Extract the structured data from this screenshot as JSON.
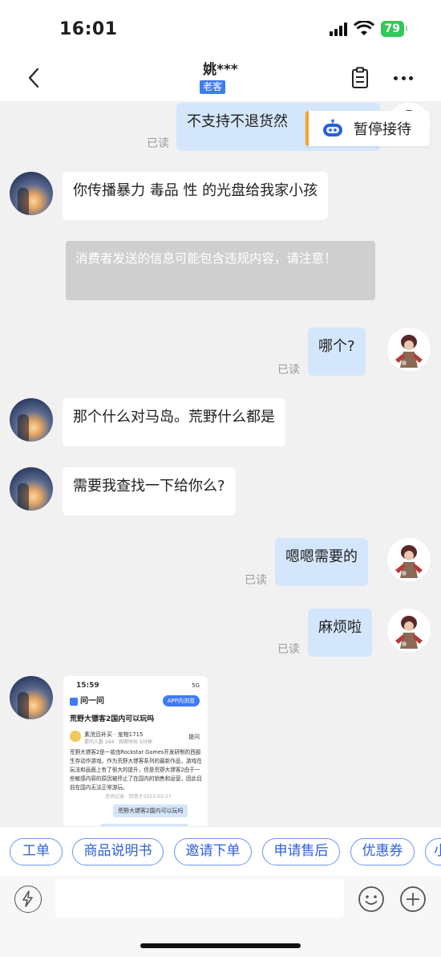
{
  "status_bar": {
    "time": "16:01",
    "battery": "79"
  },
  "header": {
    "contact_name": "姚***",
    "badge": "老客"
  },
  "messages": [
    {
      "side": "out",
      "text": "不支持不退货然",
      "read": "已读"
    },
    {
      "side": "in",
      "text": "你传播暴力 毒品 性 的光盘给我家小孩"
    },
    {
      "side": "system",
      "text": "消费者发送的信息可能包含违规内容，请注意！"
    },
    {
      "side": "out",
      "text": "哪个?",
      "read": "已读"
    },
    {
      "side": "in",
      "text": "那个什么对马岛。荒野什么都是"
    },
    {
      "side": "in",
      "text": "需要我查找一下给你么?"
    },
    {
      "side": "out",
      "text": "嗯嗯需要的",
      "read": "已读"
    },
    {
      "side": "out",
      "text": "麻烦啦",
      "read": "已读"
    }
  ],
  "pause_button": {
    "label": "暂停接待"
  },
  "screenshot": {
    "time": "15:59",
    "status": "5G",
    "app_name": "问一问",
    "app_button": "APP内浏览",
    "question": "荒野大镖客2国内可以玩吗",
    "user": "素浣且补买 · 宠物1715",
    "user_sub": "提问人数 164 · 回答时长 5分钟",
    "ask": "提问",
    "answer": "荒野大镖客2是一款由Rockstar Games开发研制的西部生存动作游戏，作为荒野大镖客系列的最新作品，游戏在玩法和画面上有了很大的提升，但是荒野大镖客2由于一些敏感内容的原因被停止了在国内的销售和运营，因此目前在国内无法正常游玩。",
    "date": "咨询记录 · 回答于2023-03-27",
    "message": "荒野大镖客2国内可以玩吗"
  },
  "quick_replies": [
    "工单",
    "商品说明书",
    "邀请下单",
    "申请售后",
    "优惠券",
    "小"
  ],
  "input": {
    "placeholder": ""
  }
}
